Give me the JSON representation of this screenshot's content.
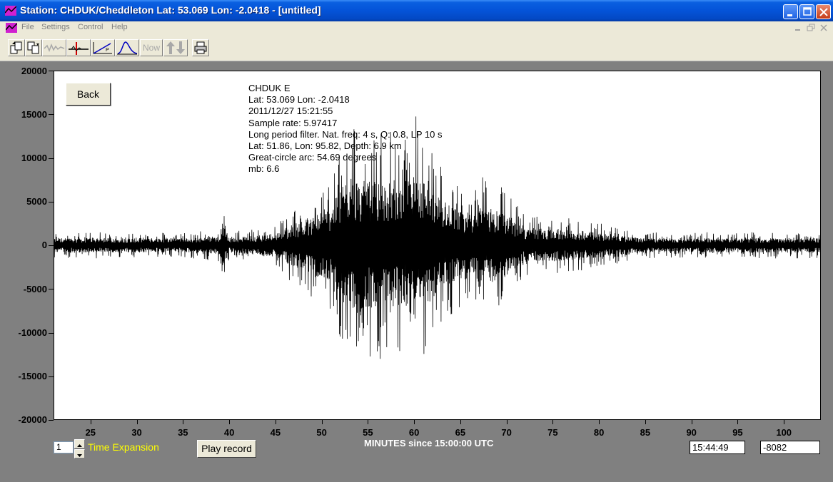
{
  "window": {
    "title": "Station: CHDUK/Cheddleton Lat: 53.069 Lon: -2.0418 - [untitled]"
  },
  "menu": {
    "items": [
      "File",
      "Settings",
      "Control",
      "Help"
    ]
  },
  "toolbar": {
    "now_label": "Now"
  },
  "info": {
    "lines": [
      "CHDUK  E",
      "Lat: 53.069 Lon: -2.0418",
      "2011/12/27 15:21:55",
      "Sample rate: 5.97417",
      "Long period filter. Nat. freq: 4 s, Q: 0.8, LP 10 s",
      "Lat: 51.86, Lon: 95.82, Depth: 6.9 km",
      "Great-circle arc: 54.69 degrees",
      "mb: 6.6"
    ]
  },
  "buttons": {
    "back": "Back",
    "play_record": "Play record"
  },
  "controls": {
    "time_expansion_value": "1",
    "time_expansion_label": "Time Expansion",
    "time_readout": "15:44:49",
    "value_readout": "-8082"
  },
  "colors": {
    "title_bar": "#0453d8",
    "window_bg": "#808080",
    "chrome": "#ece9d8",
    "trace": "#000000",
    "time_expansion_text": "#ffff00"
  },
  "chart_data": {
    "type": "line",
    "xlabel": "MINUTES since 15:00:00 UTC",
    "ylabel": "",
    "xlim": [
      21,
      104
    ],
    "ylim": [
      -20000,
      20000
    ],
    "x_ticks": [
      25,
      30,
      35,
      40,
      45,
      50,
      55,
      60,
      65,
      70,
      75,
      80,
      85,
      90,
      95,
      100
    ],
    "y_ticks": [
      20000,
      15000,
      10000,
      5000,
      0,
      -5000,
      -10000,
      -15000,
      -20000
    ],
    "series": [
      {
        "values_described_as_envelope": [
          [
            21,
            1500
          ],
          [
            36,
            1500
          ],
          [
            39,
            2000
          ],
          [
            39.3,
            5000
          ],
          [
            40,
            1500
          ],
          [
            45,
            2500
          ],
          [
            47,
            4500
          ],
          [
            49,
            6000
          ],
          [
            51,
            8000
          ],
          [
            53,
            15000
          ],
          [
            55,
            13000
          ],
          [
            57,
            13500
          ],
          [
            59,
            12000
          ],
          [
            60.1,
            16500
          ],
          [
            62,
            11000
          ],
          [
            65,
            7000
          ],
          [
            68,
            8000
          ],
          [
            69,
            7500
          ],
          [
            72,
            3500
          ],
          [
            78,
            3000
          ],
          [
            85,
            1500
          ],
          [
            104,
            1500
          ]
        ]
      }
    ]
  }
}
